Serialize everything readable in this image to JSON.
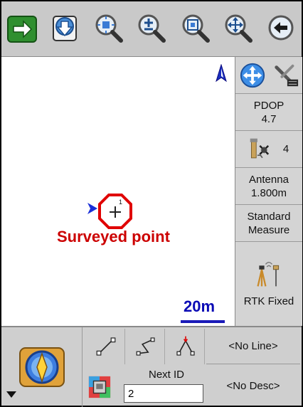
{
  "toolbar": {
    "buttons": [
      {
        "name": "exit-arrow-icon"
      },
      {
        "name": "download-icon"
      },
      {
        "name": "zoom-extents-icon"
      },
      {
        "name": "zoom-in-out-icon"
      },
      {
        "name": "zoom-window-icon"
      },
      {
        "name": "pan-icon"
      },
      {
        "name": "back-icon"
      }
    ]
  },
  "map": {
    "point_label": "Surveyed point",
    "scale_label": "20m",
    "label_color": "#cc0000",
    "scale_color": "#0a0ab5"
  },
  "right_panel": {
    "pdop_label": "PDOP",
    "pdop_value": "4.7",
    "satellite_count": "4",
    "antenna_label": "Antenna",
    "antenna_value": "1.800m",
    "measure_line1": "Standard",
    "measure_line2": "Measure",
    "status": "RTK Fixed"
  },
  "bottom": {
    "line_button": "<No Line>",
    "desc_button": "<No Desc>",
    "next_id_label": "Next ID",
    "next_id_value": "2"
  }
}
